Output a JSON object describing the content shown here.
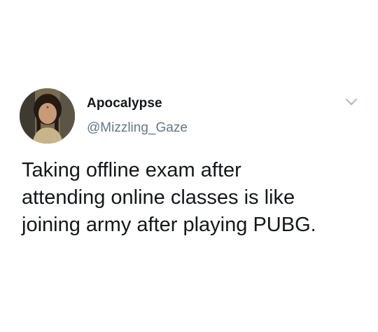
{
  "tweet": {
    "display_name": "Apocalypse",
    "handle": "@Mizzling_Gaze",
    "text_lines": [
      "Taking offline exam after",
      "attending online classes is like",
      "joining army after playing PUBG."
    ],
    "avatar_icon": "user-photo-avatar",
    "menu_icon": "chevron-down-icon"
  },
  "colors": {
    "text_primary": "#14171a",
    "text_secondary": "#657786",
    "chevron": "#aab8c2",
    "background": "#ffffff"
  }
}
